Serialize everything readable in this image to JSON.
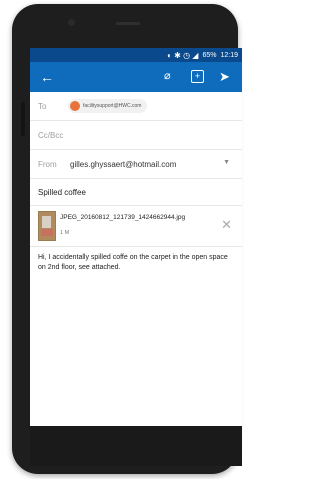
{
  "status_bar": {
    "battery": "65%",
    "time": "12:19"
  },
  "toolbar": {
    "title": ""
  },
  "compose": {
    "to_label": "To",
    "to_recipient": "facilitysupport@HWC.com",
    "ccbcc_label": "Cc/Bcc",
    "from_label": "From",
    "from_value": "gilles.ghyssaert@hotmail.com",
    "subject": "Spilled coffee",
    "attachment": {
      "name": "JPEG_20160812_121739_1424662944.jpg",
      "size": "1 M"
    },
    "body": "Hi,  I accidentally spilled coffe on the carpet in the open space on 2nd floor, see attached."
  },
  "colors": {
    "toolbar": "#0f6cbd",
    "status": "#0a4a8c",
    "avatar": "#e8743b"
  },
  "icons": [
    "back-arrow-icon",
    "attach-icon",
    "calendar-add-icon",
    "send-icon",
    "dropdown-icon",
    "close-icon"
  ]
}
